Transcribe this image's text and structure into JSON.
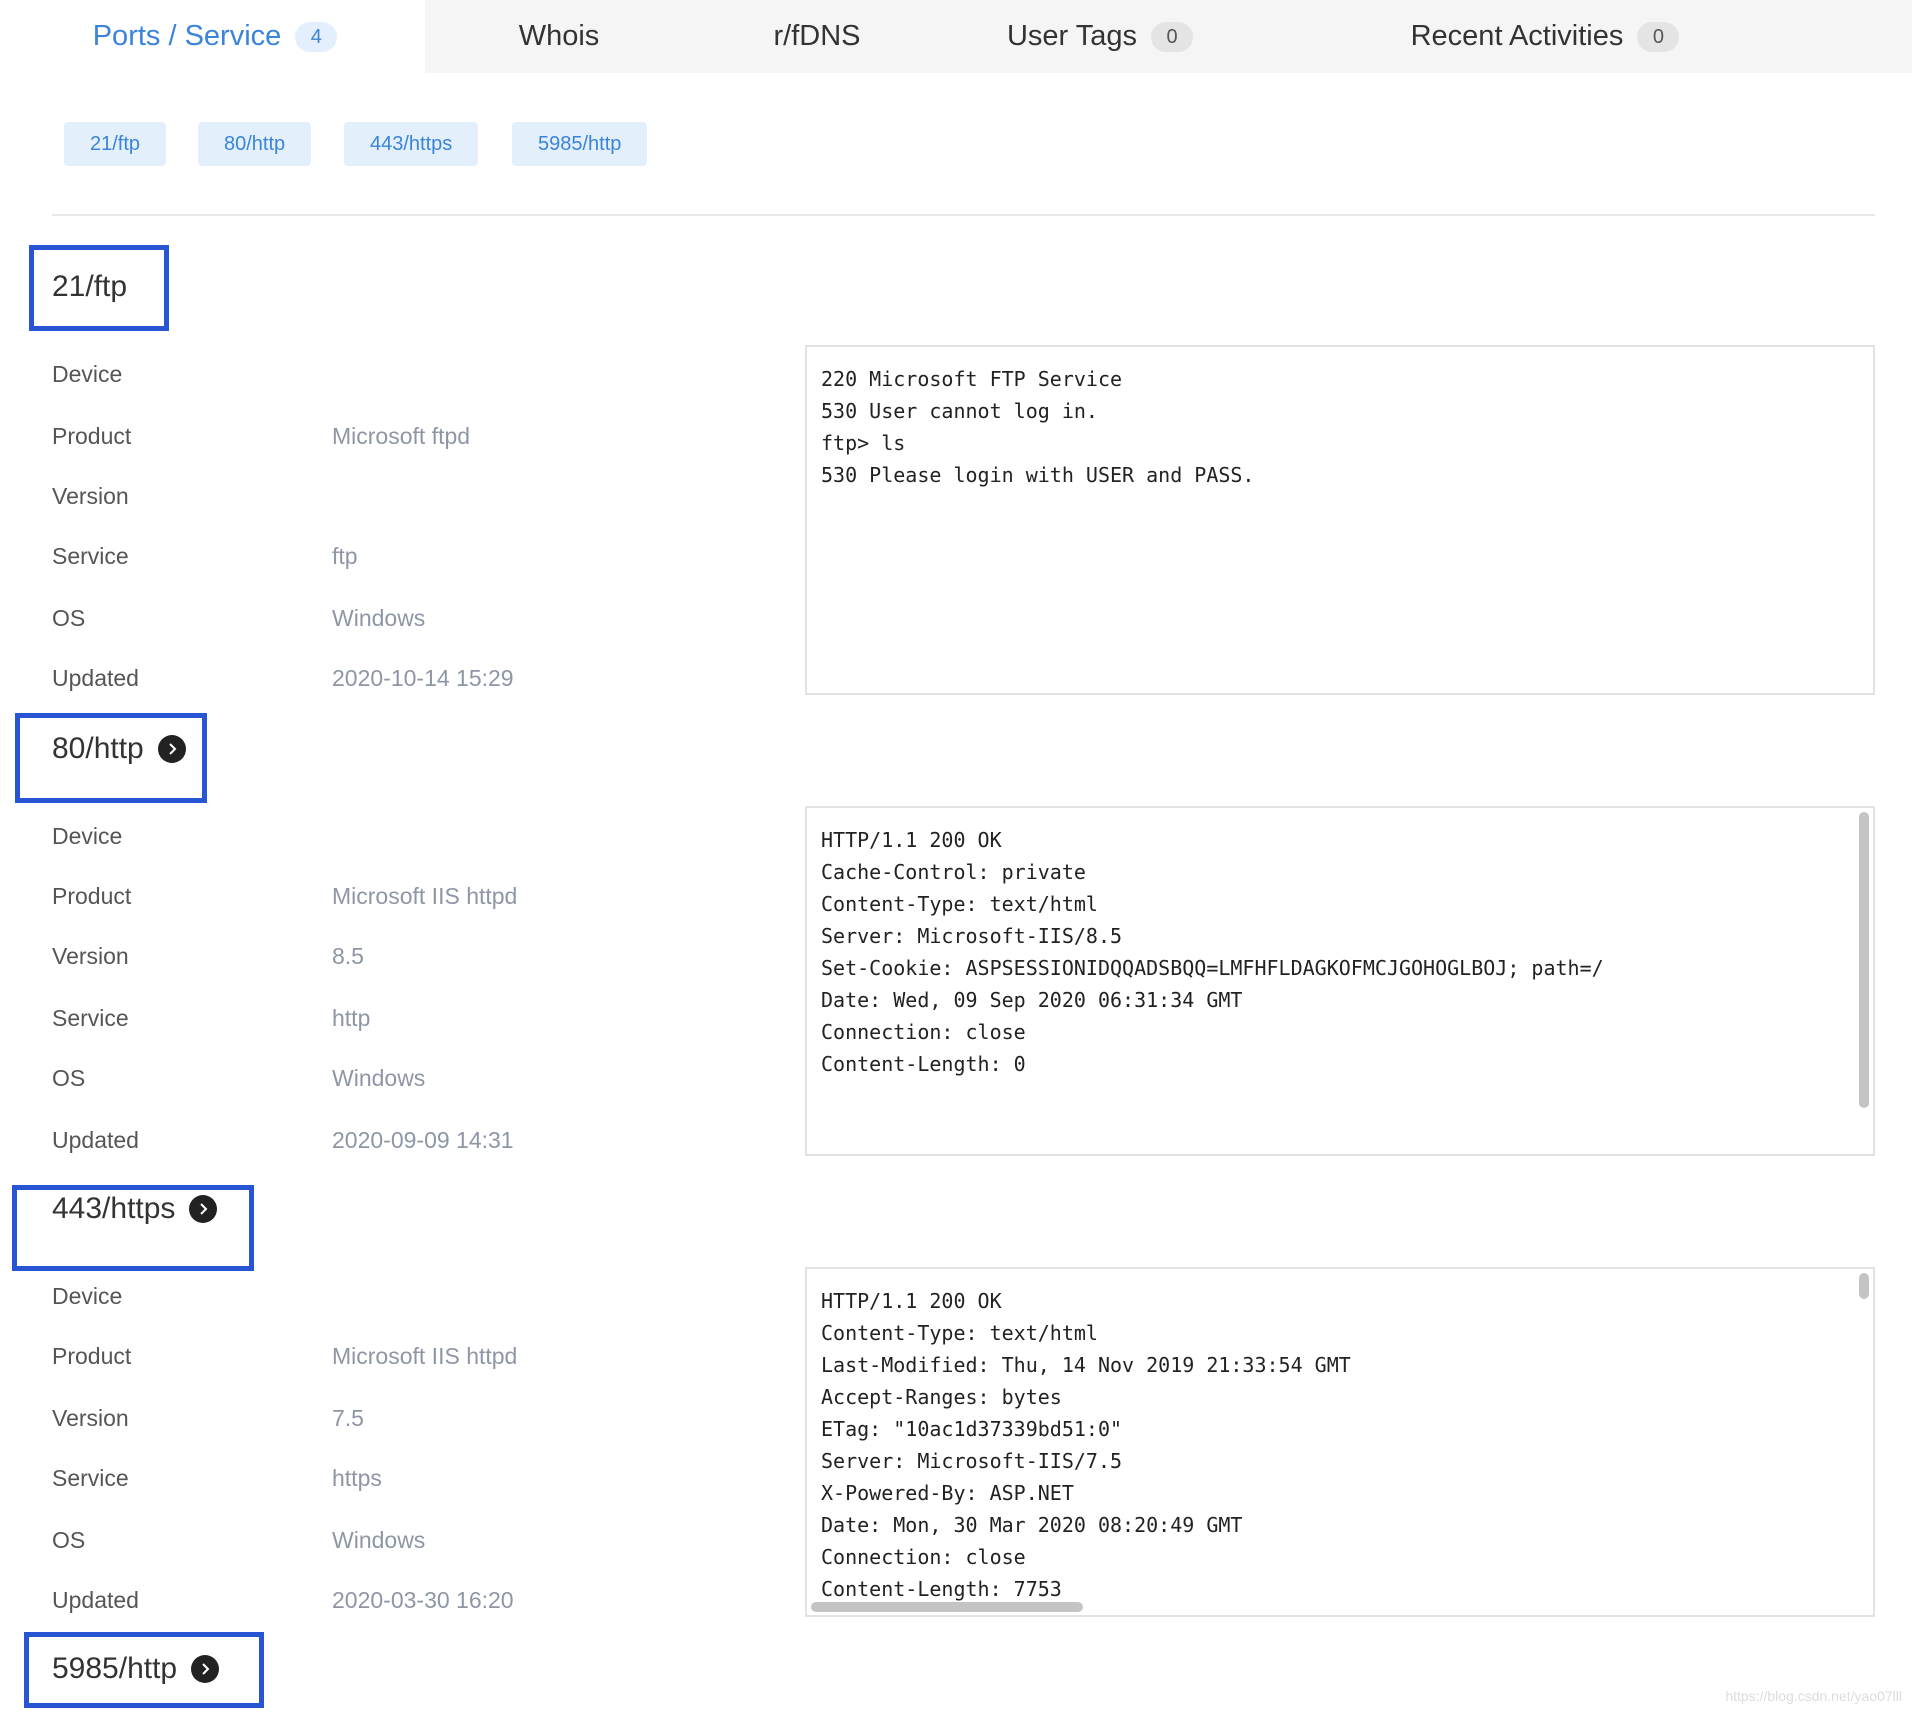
{
  "tabs": [
    {
      "label": "Ports / Service",
      "badge": "4"
    },
    {
      "label": "Whois"
    },
    {
      "label": "r/fDNS"
    },
    {
      "label": "User Tags",
      "badge": "0"
    },
    {
      "label": "Recent Activities",
      "badge": "0"
    }
  ],
  "chips": [
    "21/ftp",
    "80/http",
    "443/https",
    "5985/http"
  ],
  "field_labels": {
    "device": "Device",
    "product": "Product",
    "version": "Version",
    "service": "Service",
    "os": "OS",
    "updated": "Updated"
  },
  "sections": [
    {
      "title": "21/ftp",
      "product": "Microsoft ftpd",
      "version": "",
      "service": "ftp",
      "os": "Windows",
      "updated": "2020-10-14 15:29",
      "banner": "220 Microsoft FTP Service\n530 User cannot log in.\nftp> ls\n530 Please login with USER and PASS."
    },
    {
      "title": "80/http",
      "product": "Microsoft IIS httpd",
      "version": "8.5",
      "service": "http",
      "os": "Windows",
      "updated": "2020-09-09 14:31",
      "banner": "HTTP/1.1 200 OK\nCache-Control: private\nContent-Type: text/html\nServer: Microsoft-IIS/8.5\nSet-Cookie: ASPSESSIONIDQQADSBQQ=LMFHFLDAGKOFMCJGOHOGLBOJ; path=/\nDate: Wed, 09 Sep 2020 06:31:34 GMT\nConnection: close\nContent-Length: 0"
    },
    {
      "title": "443/https",
      "product": "Microsoft IIS httpd",
      "version": "7.5",
      "service": "https",
      "os": "Windows",
      "updated": "2020-03-30 16:20",
      "banner": "HTTP/1.1 200 OK\nContent-Type: text/html\nLast-Modified: Thu, 14 Nov 2019 21:33:54 GMT\nAccept-Ranges: bytes\nETag: \"10ac1d37339bd51:0\"\nServer: Microsoft-IIS/7.5\nX-Powered-By: ASP.NET\nDate: Mon, 30 Mar 2020 08:20:49 GMT\nConnection: close\nContent-Length: 7753"
    },
    {
      "title": "5985/http"
    }
  ],
  "watermark": "https://blog.csdn.net/yao07lll",
  "colors": {
    "accent": "#3a84d9",
    "annotation": "#2755d4",
    "value_text": "#8e96a6"
  },
  "icons": {
    "go": "chevron-right-circle-icon"
  }
}
